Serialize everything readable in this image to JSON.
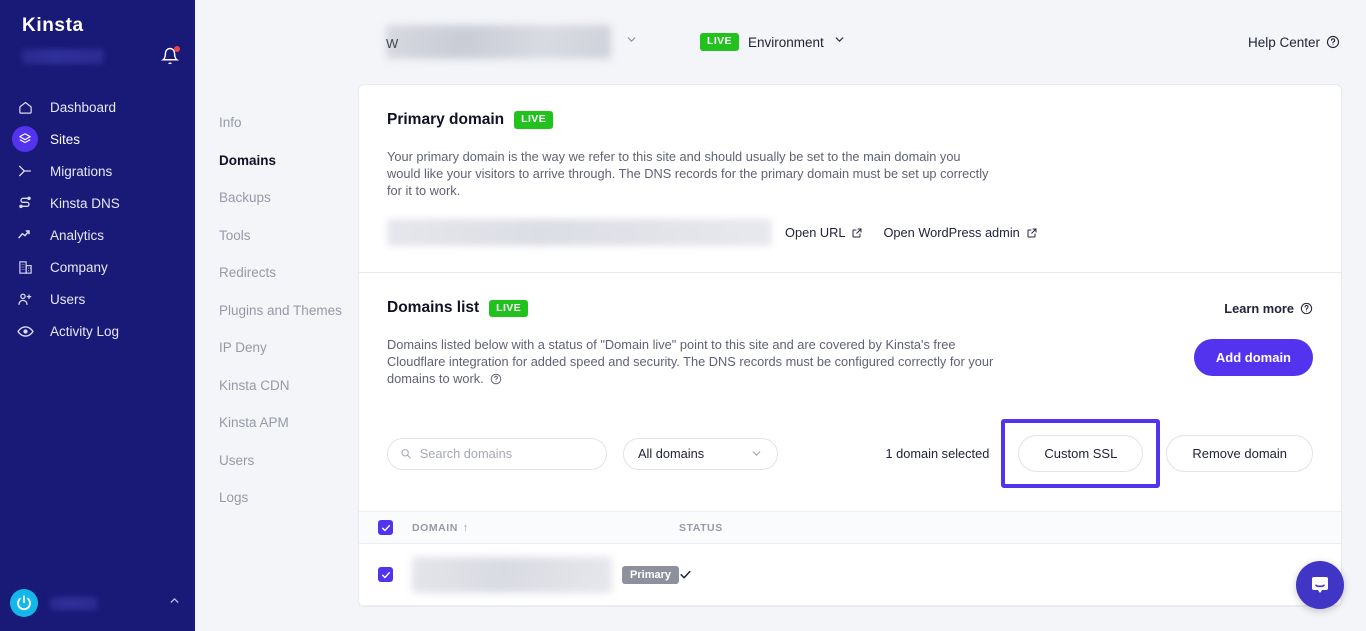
{
  "sidebar": {
    "brand": "Kinsta",
    "company_name_hidden": "",
    "bell_icon": "bell-icon",
    "items": [
      {
        "label": "Dashboard",
        "icon": "home-icon",
        "active": false
      },
      {
        "label": "Sites",
        "icon": "layers-icon",
        "active": true
      },
      {
        "label": "Migrations",
        "icon": "migration-arrow-icon",
        "active": false
      },
      {
        "label": "Kinsta DNS",
        "icon": "dns-icon",
        "active": false
      },
      {
        "label": "Analytics",
        "icon": "analytics-icon",
        "active": false
      },
      {
        "label": "Company",
        "icon": "building-icon",
        "active": false
      },
      {
        "label": "Users",
        "icon": "user-plus-icon",
        "active": false
      },
      {
        "label": "Activity Log",
        "icon": "eye-icon",
        "active": false
      }
    ],
    "user_name_hidden": "",
    "collapse_icon": "chevron-up-icon"
  },
  "subnav": {
    "items": [
      {
        "label": "Info",
        "active": false
      },
      {
        "label": "Domains",
        "active": true
      },
      {
        "label": "Backups",
        "active": false
      },
      {
        "label": "Tools",
        "active": false
      },
      {
        "label": "Redirects",
        "active": false
      },
      {
        "label": "Plugins and Themes",
        "active": false
      },
      {
        "label": "IP Deny",
        "active": false
      },
      {
        "label": "Kinsta CDN",
        "active": false
      },
      {
        "label": "Kinsta APM",
        "active": false
      },
      {
        "label": "Users",
        "active": false
      },
      {
        "label": "Logs",
        "active": false
      }
    ]
  },
  "topbar": {
    "site_name_hidden": "W",
    "site_dropdown_icon": "chevron-down-icon",
    "live_badge": "LIVE",
    "environment_label": "Environment",
    "environment_dropdown_icon": "chevron-down-icon",
    "help_center": "Help Center",
    "help_icon": "question-circle-icon"
  },
  "primary_domain": {
    "title": "Primary domain",
    "badge": "LIVE",
    "description": "Your primary domain is the way we refer to this site and should usually be set to the main domain you would like your visitors to arrive through. The DNS records for the primary domain must be set up correctly for it to work.",
    "domain_value_hidden": "",
    "open_url_label": "Open URL",
    "open_wp_admin_label": "Open WordPress admin",
    "external_link_icon": "external-link-icon"
  },
  "domains_list": {
    "title": "Domains list",
    "badge": "LIVE",
    "description": "Domains listed below with a status of \"Domain live\" point to this site and are covered by Kinsta's free Cloudflare integration for added speed and security. The DNS records must be configured correctly for your domains to work.",
    "description_help_icon": "question-circle-icon",
    "learn_more": "Learn more",
    "learn_more_icon": "question-circle-icon",
    "add_domain_button": "Add domain",
    "search_placeholder": "Search domains",
    "search_value": "",
    "search_icon": "search-icon",
    "filter_selected": "All domains",
    "filter_icon": "chevron-down-icon",
    "selection_count": "1 domain selected",
    "custom_ssl_button": "Custom SSL",
    "remove_domain_button": "Remove domain",
    "table": {
      "columns": [
        "DOMAIN",
        "STATUS"
      ],
      "sort_indicator": "↑",
      "header_checkbox_checked": true,
      "rows": [
        {
          "checked": true,
          "domain_hidden": "",
          "badge": "Primary",
          "status_icon": "check-icon",
          "kebab_icon": "more-vertical-icon"
        }
      ]
    }
  },
  "annotation": {
    "highlight_target": "Custom SSL",
    "highlight_color": "#5333ed"
  },
  "chat_widget": {
    "icon": "intercom-chat-icon"
  },
  "colors": {
    "sidebar_bg": "#191978",
    "accent": "#5333ed",
    "live_green": "#21c11e",
    "page_bg": "#f4f5f8"
  }
}
